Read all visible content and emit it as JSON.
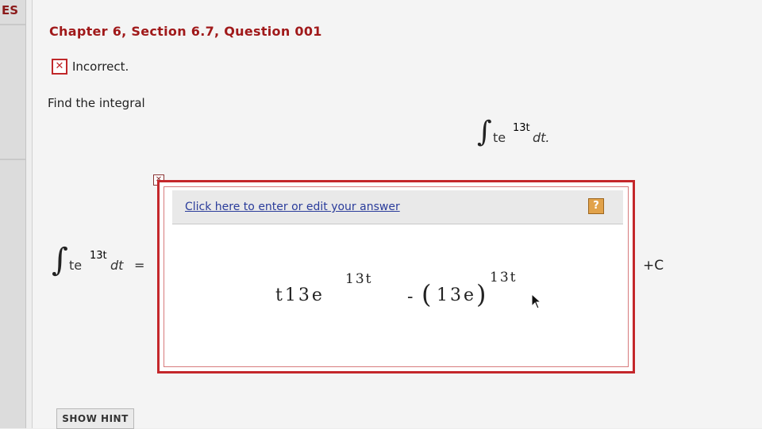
{
  "sidebar": {
    "tab_fragment": "ES"
  },
  "question": {
    "title": "Chapter 6, Section 6.7, Question 001",
    "status": {
      "icon_name": "x-icon",
      "text": "Incorrect."
    },
    "prompt": "Find the integral",
    "integral_display": {
      "symbol": "∫",
      "base": "te",
      "exponent": "13t",
      "differential": "dt."
    }
  },
  "answer": {
    "lhs": {
      "symbol": "∫",
      "base": "te",
      "exponent": "13t",
      "differential": "dt",
      "equals": "="
    },
    "editor": {
      "link_label": "Click here to enter or edit your answer",
      "help_label": "?"
    },
    "expression": {
      "part1": "t13e",
      "part1_exp": "13t",
      "minus": "-",
      "paren_open": "(",
      "part2": "13e",
      "paren_close": ")",
      "part2_exp": "13t"
    },
    "plus_c": "+C"
  },
  "hint": {
    "label": "SHOW HINT"
  },
  "colors": {
    "accent_red": "#c4272b",
    "title_red": "#a0191a",
    "link_blue": "#2a3c9b"
  }
}
